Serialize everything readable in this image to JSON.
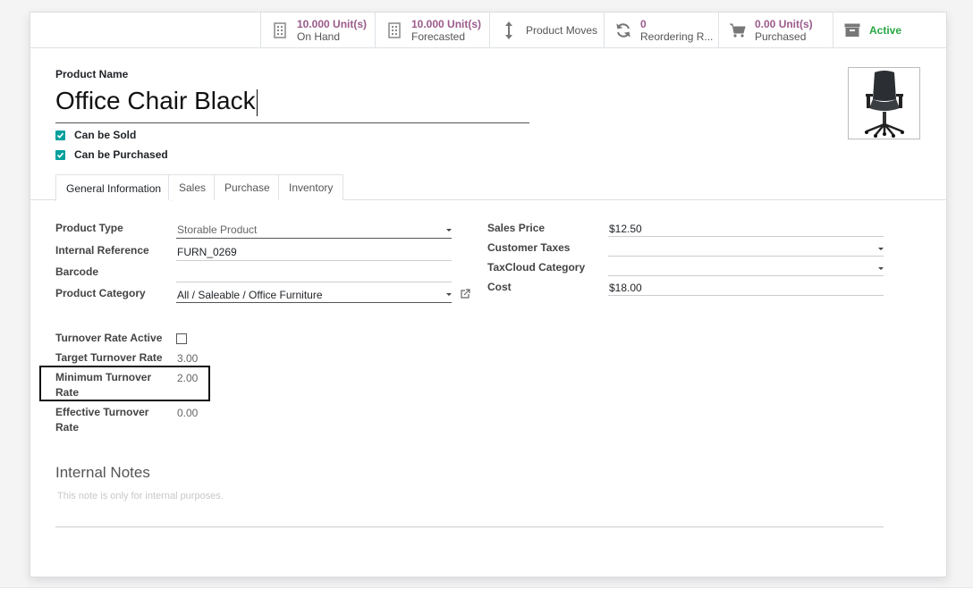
{
  "smart_buttons": [
    {
      "value": "10.000 Unit(s)",
      "label": "On Hand",
      "icon": "building-icon"
    },
    {
      "value": "10.000 Unit(s)",
      "label": "Forecasted",
      "icon": "building-icon"
    },
    {
      "label": "Product Moves",
      "icon": "up-down-arrow-icon"
    },
    {
      "value": "0",
      "label": "Reordering R...",
      "icon": "refresh-icon"
    },
    {
      "value": "0.00 Unit(s)",
      "label": "Purchased",
      "icon": "cart-icon"
    },
    {
      "label": "Active",
      "icon": "archive-icon"
    }
  ],
  "product": {
    "name_label": "Product Name",
    "name": "Office Chair Black",
    "can_be_sold": "Can be Sold",
    "can_be_purchased": "Can be Purchased"
  },
  "tabs": [
    "General Information",
    "Sales",
    "Purchase",
    "Inventory"
  ],
  "left_fields": {
    "product_type": {
      "label": "Product Type",
      "value": "Storable Product"
    },
    "internal_reference": {
      "label": "Internal Reference",
      "value": "FURN_0269"
    },
    "barcode": {
      "label": "Barcode",
      "value": ""
    },
    "product_category": {
      "label": "Product Category",
      "value": "All / Saleable / Office Furniture"
    }
  },
  "right_fields": {
    "sales_price": {
      "label": "Sales Price",
      "value": "$12.50"
    },
    "customer_taxes": {
      "label": "Customer Taxes",
      "value": ""
    },
    "taxcloud_category": {
      "label": "TaxCloud Category",
      "value": ""
    },
    "cost": {
      "label": "Cost",
      "value": "$18.00"
    }
  },
  "turnover": {
    "active_label": "Turnover Rate Active",
    "target_label": "Target Turnover Rate",
    "target_value": "3.00",
    "minimum_label_1": "Minimum Turnover",
    "minimum_label_2": "Rate",
    "minimum_value": "2.00",
    "effective_label_1": "Effective Turnover",
    "effective_label_2": "Rate",
    "effective_value": "0.00"
  },
  "notes": {
    "title": "Internal Notes",
    "placeholder": "This note is only for internal purposes."
  },
  "colors": {
    "accent": "#9b5a8c",
    "active_green": "#28a745",
    "checkbox_teal": "#00a09d"
  }
}
